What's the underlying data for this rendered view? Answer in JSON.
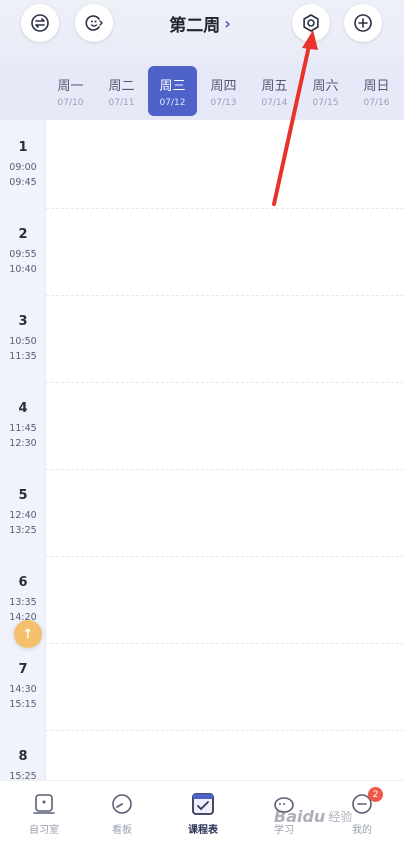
{
  "header": {
    "week_title": "第二周",
    "chevron": "›"
  },
  "days": [
    {
      "name": "周一",
      "date": "07/10",
      "active": false
    },
    {
      "name": "周二",
      "date": "07/11",
      "active": false
    },
    {
      "name": "周三",
      "date": "07/12",
      "active": true
    },
    {
      "name": "周四",
      "date": "07/13",
      "active": false
    },
    {
      "name": "周五",
      "date": "07/14",
      "active": false
    },
    {
      "name": "周六",
      "date": "07/15",
      "active": false
    },
    {
      "name": "周日",
      "date": "07/16",
      "active": false
    }
  ],
  "periods": [
    {
      "num": "1",
      "start": "09:00",
      "end": "09:45"
    },
    {
      "num": "2",
      "start": "09:55",
      "end": "10:40"
    },
    {
      "num": "3",
      "start": "10:50",
      "end": "11:35"
    },
    {
      "num": "4",
      "start": "11:45",
      "end": "12:30"
    },
    {
      "num": "5",
      "start": "12:40",
      "end": "13:25"
    },
    {
      "num": "6",
      "start": "13:35",
      "end": "14:20"
    },
    {
      "num": "7",
      "start": "14:30",
      "end": "15:15"
    },
    {
      "num": "8",
      "start": "15:25",
      "end": ""
    }
  ],
  "float_button": "↑",
  "nav": [
    {
      "label": "自习室",
      "icon": "study-room-icon",
      "active": false
    },
    {
      "label": "看板",
      "icon": "dashboard-icon",
      "active": false
    },
    {
      "label": "课程表",
      "icon": "timetable-icon",
      "active": true
    },
    {
      "label": "学习",
      "icon": "study-icon",
      "active": false
    },
    {
      "label": "我的",
      "icon": "profile-icon",
      "active": false,
      "badge": "2"
    }
  ],
  "watermark": {
    "brand": "Baidu",
    "suffix": "经验"
  },
  "colors": {
    "accent": "#4f62c9",
    "arrow": "#e8332c",
    "badge": "#f0594a",
    "float_button": "#f5c06b"
  }
}
